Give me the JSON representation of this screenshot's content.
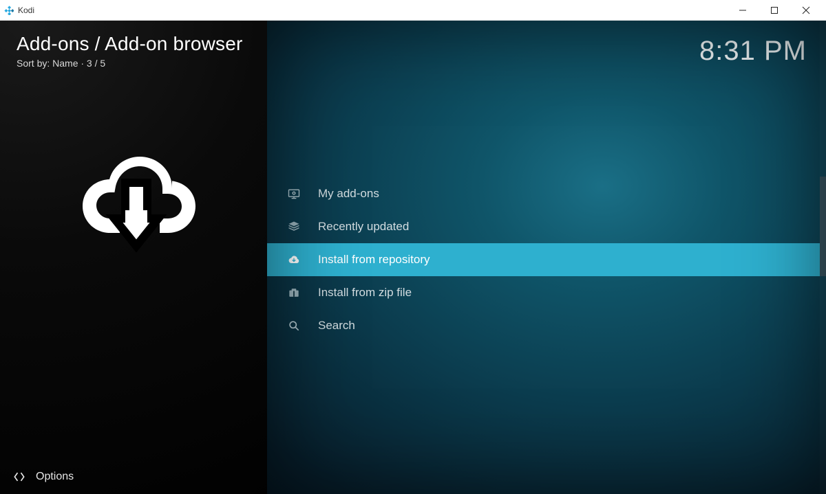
{
  "window": {
    "title": "Kodi"
  },
  "header": {
    "breadcrumb": "Add-ons / Add-on browser",
    "sort_line": "Sort by: Name  ·  3 / 5",
    "clock": "8:31 PM"
  },
  "menu": {
    "items": [
      {
        "label": "My add-ons",
        "icon": "monitor-addons-icon",
        "selected": false
      },
      {
        "label": "Recently updated",
        "icon": "box-open-icon",
        "selected": false
      },
      {
        "label": "Install from repository",
        "icon": "cloud-download-icon",
        "selected": true
      },
      {
        "label": "Install from zip file",
        "icon": "zip-file-icon",
        "selected": false
      },
      {
        "label": "Search",
        "icon": "search-icon",
        "selected": false
      }
    ],
    "selected_index": 2,
    "count": 5
  },
  "footer": {
    "options_label": "Options"
  },
  "scrollbar": {
    "thumb_top_pct": 33,
    "thumb_height_pct": 21
  }
}
